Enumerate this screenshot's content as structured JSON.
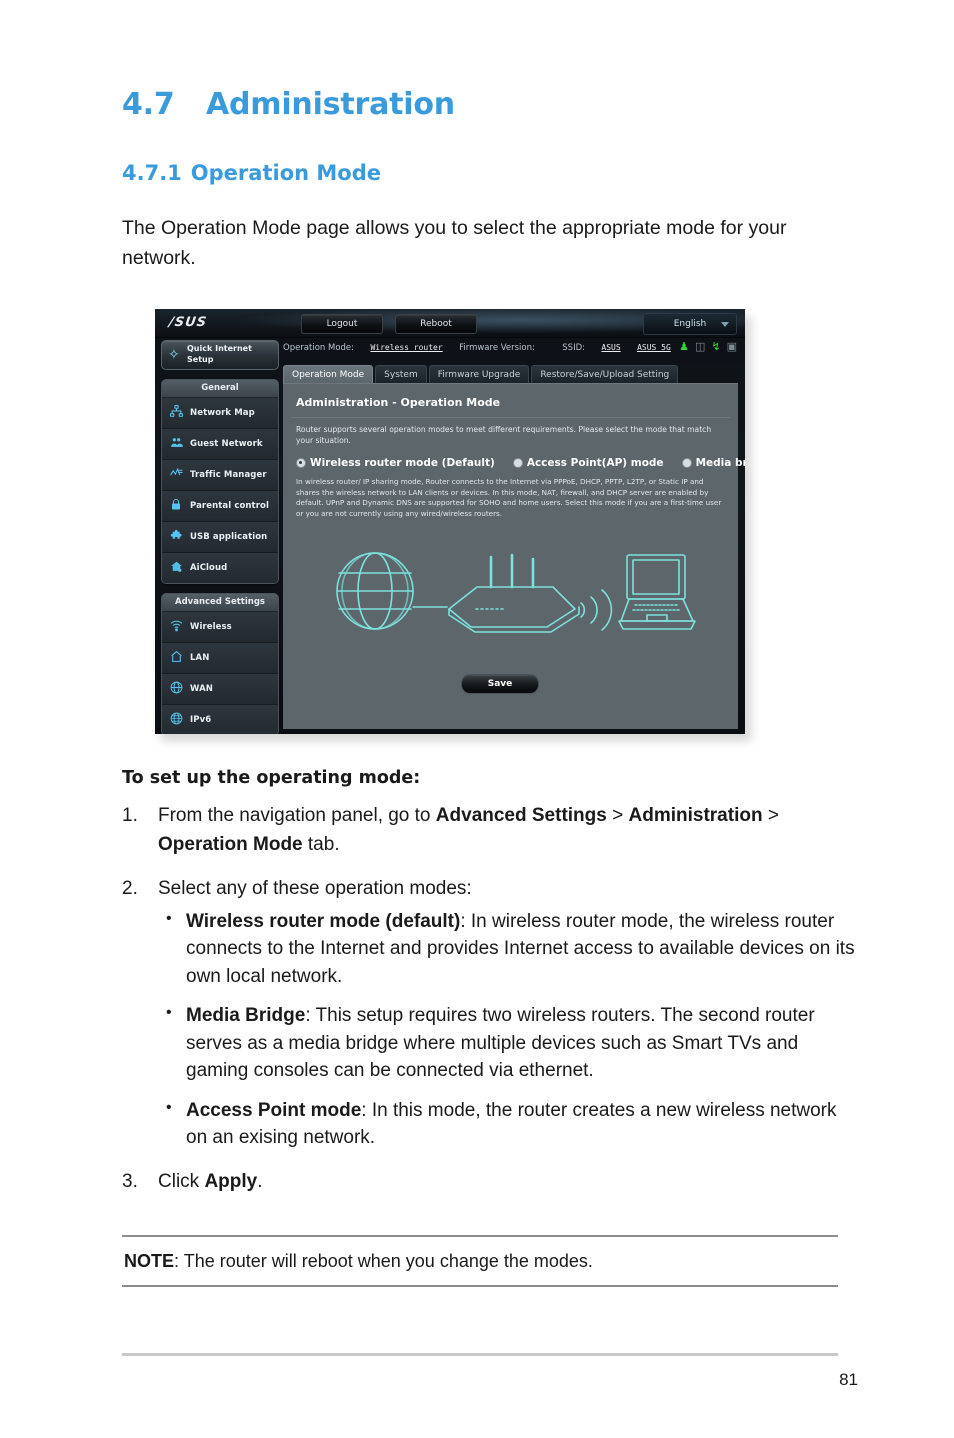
{
  "document": {
    "section_number": "4.7",
    "section_title": "Administration",
    "subsection_number": "4.7.1",
    "subsection_title": "Operation Mode",
    "intro": "The Operation Mode page allows you to select the appropriate mode for your network.",
    "howto_heading": "To set up the operating mode:",
    "steps": [
      {
        "number": "1.",
        "parts": [
          {
            "text": "From the navigation panel, go to ",
            "bold": false
          },
          {
            "text": "Advanced Settings",
            "bold": true
          },
          {
            "text": " > ",
            "bold": false
          },
          {
            "text": "Administration",
            "bold": true
          },
          {
            "text": " > ",
            "bold": false
          },
          {
            "text": "Operation Mode",
            "bold": true
          },
          {
            "text": " tab.",
            "bold": false
          }
        ]
      },
      {
        "number": "2.",
        "parts": [
          {
            "text": "Select any of these operation modes:",
            "bold": false
          }
        ],
        "bullets": [
          {
            "marker": "•",
            "parts": [
              {
                "text": "Wireless router mode (default)",
                "bold": true
              },
              {
                "text": ": In wireless router mode, the wireless router connects to the Internet and provides Internet access to available devices on its own local network.",
                "bold": false
              }
            ]
          },
          {
            "marker": "•",
            "parts": [
              {
                "text": "Media Bridge",
                "bold": true
              },
              {
                "text": ": This setup requires two wireless routers. The second router serves as a media bridge where multiple devices such as Smart TVs and gaming consoles can be connected via ethernet.",
                "bold": false
              }
            ]
          },
          {
            "marker": "•",
            "parts": [
              {
                "text": "Access Point mode",
                "bold": true
              },
              {
                "text": ": In this mode, the router creates a new wireless network on an exising network.",
                "bold": false
              }
            ]
          }
        ]
      },
      {
        "number": "3.",
        "parts": [
          {
            "text": "Click ",
            "bold": false
          },
          {
            "text": "Apply",
            "bold": true
          },
          {
            "text": ".",
            "bold": false
          }
        ]
      }
    ],
    "note_label": "NOTE",
    "note_text": ":  The router will reboot when you change the modes.",
    "page_number": "81"
  },
  "colors": {
    "heading_blue": "#3a9bdc",
    "panel_gray": "#5c666b",
    "icon_cyan": "#56c4ee",
    "diagram_teal": "#7ee0dd",
    "status_green": "#35d13a"
  },
  "screenshot": {
    "brand": "/SUS",
    "top_buttons": [
      {
        "label": "Logout"
      },
      {
        "label": "Reboot"
      }
    ],
    "language": {
      "value": "English",
      "caret": "chevron-down-icon"
    },
    "status": {
      "operation_mode_label": "Operation Mode:",
      "operation_mode_value": "Wireless_router",
      "firmware_label": "Firmware Version:",
      "firmware_value": "",
      "ssid_label": "SSID:",
      "ssid_value_1": "ASUS",
      "ssid_value_2": "ASUS_5G",
      "icons": [
        "guest-network-icon",
        "copy-icon",
        "usb-icon",
        "printer-icon"
      ]
    },
    "tabs": [
      {
        "label": "Operation Mode",
        "active": true
      },
      {
        "label": "System",
        "active": false
      },
      {
        "label": "Firmware Upgrade",
        "active": false
      },
      {
        "label": "Restore/Save/Upload Setting",
        "active": false
      }
    ],
    "quick_setup": {
      "line1": "Quick Internet",
      "line2": "Setup",
      "icon": "magic-wand-icon"
    },
    "nav_groups": [
      {
        "title": "General",
        "items": [
          {
            "label": "Network Map",
            "icon": "network-map-icon",
            "glyph": "⛓"
          },
          {
            "label": "Guest Network",
            "icon": "guest-network-icon",
            "glyph": "⛟"
          },
          {
            "label": "Traffic Manager",
            "icon": "traffic-manager-icon",
            "glyph": "⌁"
          },
          {
            "label": "Parental control",
            "icon": "lock-icon",
            "glyph": "⚿"
          },
          {
            "label": "USB application",
            "icon": "usb-puzzle-icon",
            "glyph": "❖"
          },
          {
            "label": "AiCloud",
            "icon": "cloud-house-icon",
            "glyph": "☁"
          }
        ]
      },
      {
        "title": "Advanced Settings",
        "items": [
          {
            "label": "Wireless",
            "icon": "wifi-icon",
            "glyph": "◔"
          },
          {
            "label": "LAN",
            "icon": "home-icon",
            "glyph": "⌂"
          },
          {
            "label": "WAN",
            "icon": "globe-icon",
            "glyph": "⊕"
          },
          {
            "label": "IPv6",
            "icon": "globe-grid-icon",
            "glyph": "⊕"
          }
        ]
      }
    ],
    "main": {
      "title": "Administration - Operation Mode",
      "description": "Router supports several operation modes to meet different requirements. Please select the mode that match your situation.",
      "modes": [
        {
          "label": "Wireless router mode (Default)",
          "selected": true
        },
        {
          "label": "Access Point(AP) mode",
          "selected": false
        },
        {
          "label": "Media bridge",
          "selected": false
        }
      ],
      "mode_description": "In wireless router/ IP sharing mode, Router connects to the Internet via PPPoE, DHCP, PPTP, L2TP, or Static IP and shares the wireless network to LAN clients or devices. In this mode, NAT, firewall, and DHCP server are enabled by default. UPnP and Dynamic DNS are supported for SOHO and home users. Select this mode if you are a first-time user or you are not currently using any wired/wireless routers.",
      "save_button": "Save",
      "diagram": {
        "nodes": [
          "globe-icon",
          "router-icon",
          "wifi-waves-icon",
          "laptop-icon"
        ]
      }
    }
  }
}
